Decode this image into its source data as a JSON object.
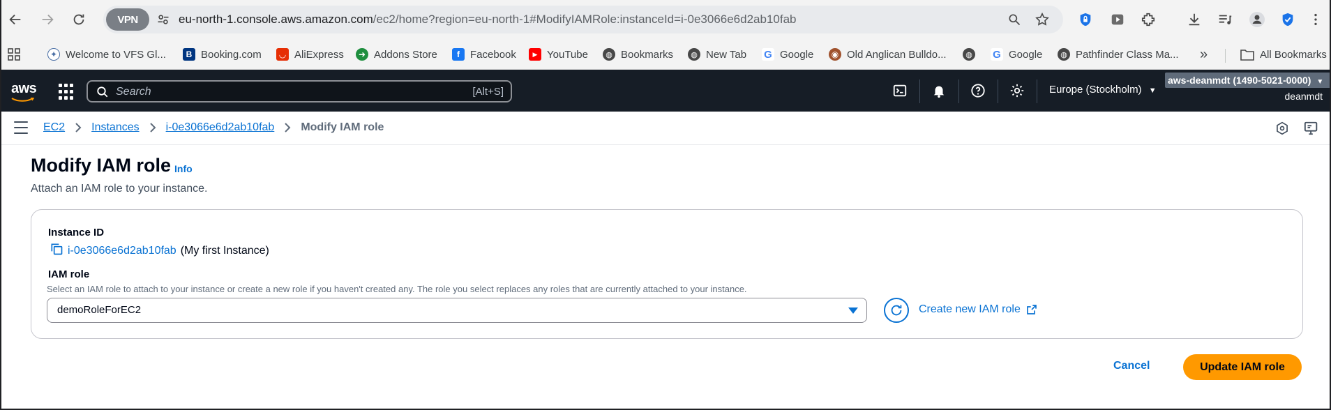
{
  "browser": {
    "vpn_label": "VPN",
    "url_host": "eu-north-1.console.aws.amazon.com",
    "url_path": "/ec2/home?region=eu-north-1#ModifyIAMRole:instanceId=i-0e3066e6d2ab10fab",
    "bookmarks": [
      {
        "label": "Welcome to VFS Gl...",
        "icon": "vfs-icon"
      },
      {
        "label": "Booking.com",
        "icon": "booking-icon"
      },
      {
        "label": "AliExpress",
        "icon": "aliexpress-icon"
      },
      {
        "label": "Addons Store",
        "icon": "addons-icon"
      },
      {
        "label": "Facebook",
        "icon": "facebook-icon"
      },
      {
        "label": "YouTube",
        "icon": "youtube-icon"
      },
      {
        "label": "Bookmarks",
        "icon": "globe-icon"
      },
      {
        "label": "New Tab",
        "icon": "globe-icon"
      },
      {
        "label": "Google",
        "icon": "google-icon"
      },
      {
        "label": "Old Anglican Bulldo...",
        "icon": "dog-icon"
      },
      {
        "label": "",
        "icon": "globe-icon"
      },
      {
        "label": "Google",
        "icon": "google-icon"
      },
      {
        "label": "Pathfinder Class Ma...",
        "icon": "globe-icon"
      }
    ],
    "overflow_label": "»",
    "all_bookmarks_label": "All Bookmarks"
  },
  "aws_header": {
    "logo_text": "aws",
    "search_placeholder": "Search",
    "search_shortcut": "[Alt+S]",
    "region": "Europe (Stockholm)",
    "account": "aws-deanmdt (1490-5021-0000)",
    "username": "deanmdt"
  },
  "breadcrumb": {
    "items": [
      "EC2",
      "Instances",
      "i-0e3066e6d2ab10fab"
    ],
    "current": "Modify IAM role"
  },
  "page": {
    "title": "Modify IAM role",
    "info_link": "Info",
    "description": "Attach an IAM role to your instance.",
    "instance_id_label": "Instance ID",
    "instance_id": "i-0e3066e6d2ab10fab",
    "instance_name": "(My first Instance)",
    "iam_role_label": "IAM role",
    "iam_role_hint": "Select an IAM role to attach to your instance or create a new role if you haven't created any. The role you select replaces any roles that are currently attached to your instance.",
    "iam_role_selected": "demoRoleForEC2",
    "create_role_link": "Create new IAM role",
    "cancel_label": "Cancel",
    "submit_label": "Update IAM role"
  },
  "colors": {
    "link": "#0972d3",
    "primary_button": "#ff9900",
    "aws_header_bg": "#161d26"
  }
}
